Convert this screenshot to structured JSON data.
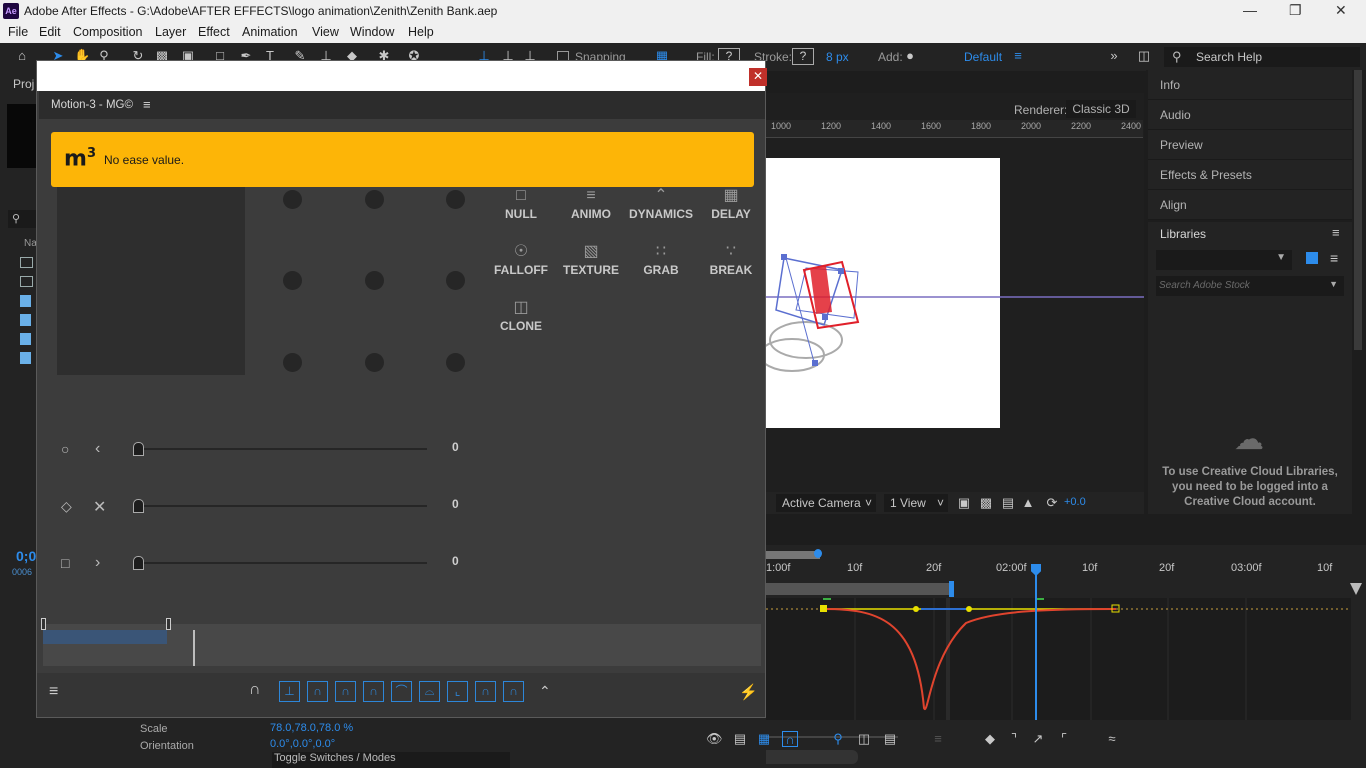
{
  "window": {
    "title": "Adobe After Effects - G:\\Adobe\\AFTER EFFECTS\\logo animation\\Zenith\\Zenith Bank.aep",
    "app_icon": "Ae"
  },
  "menu": [
    "File",
    "Edit",
    "Composition",
    "Layer",
    "Effect",
    "Animation",
    "View",
    "Window",
    "Help"
  ],
  "toolbar": {
    "snapping": "Snapping",
    "fill_label": "Fill:",
    "stroke_label": "Stroke:",
    "stroke_value": "8 px",
    "add_label": "Add:",
    "workspace": "Default",
    "search_placeholder": "Search Help"
  },
  "right_panel": {
    "items": [
      "Info",
      "Audio",
      "Preview",
      "Effects & Presets",
      "Align",
      "Libraries"
    ],
    "search_placeholder": "Search Adobe Stock",
    "cc_message": "To use Creative Cloud Libraries, you need to be logged into a Creative Cloud account."
  },
  "plugin": {
    "title": "Motion-3 - MG©",
    "alert_logo": "m",
    "alert_sup": "3",
    "alert_message": "No ease value.",
    "tools": [
      {
        "label": "NULL",
        "icon": "null-icon"
      },
      {
        "label": "ANIMO",
        "icon": "animo-icon"
      },
      {
        "label": "DYNAMICS",
        "icon": "dynamics-icon"
      },
      {
        "label": "DELAY",
        "icon": "delay-icon"
      },
      {
        "label": "FALLOFF",
        "icon": "falloff-icon"
      },
      {
        "label": "TEXTURE",
        "icon": "texture-icon"
      },
      {
        "label": "GRAB",
        "icon": "grab-icon"
      },
      {
        "label": "BREAK",
        "icon": "break-icon"
      },
      {
        "label": "CLONE",
        "icon": "clone-icon"
      }
    ],
    "sliders": [
      {
        "value": "0",
        "shape": "circle",
        "arrow": "left-chevron"
      },
      {
        "value": "0",
        "shape": "diamond",
        "arrow": "cross"
      },
      {
        "value": "0",
        "shape": "square",
        "arrow": "right-chevron"
      }
    ]
  },
  "comp": {
    "renderer_label": "Renderer:",
    "renderer_value": "Classic 3D",
    "ruler_ticks": [
      "1000",
      "1200",
      "1400",
      "1600",
      "1800",
      "2000",
      "2200",
      "2400"
    ],
    "camera": "Active Camera",
    "views": "1 View",
    "exposure": "+0.0"
  },
  "timeline": {
    "time_marks": [
      "1:00f",
      "10f",
      "20f",
      "02:00f",
      "10f",
      "20f",
      "03:00f",
      "10f"
    ],
    "time_display": "0;0",
    "frame_display": "0006",
    "props": [
      {
        "name": "Scale",
        "value": "78.0,78.0,78.0 %"
      },
      {
        "name": "Orientation",
        "value": "0.0°,0.0°,0.0°"
      }
    ],
    "toggle_label": "Toggle Switches / Modes"
  },
  "project_panel": {
    "tab": "Proj",
    "col_name": "Na"
  },
  "colors": {
    "alert": "#fdb507",
    "accent_blue": "#2d8ceb",
    "curve_red": "#e0442e",
    "keyframe_yellow": "#e8e000"
  }
}
